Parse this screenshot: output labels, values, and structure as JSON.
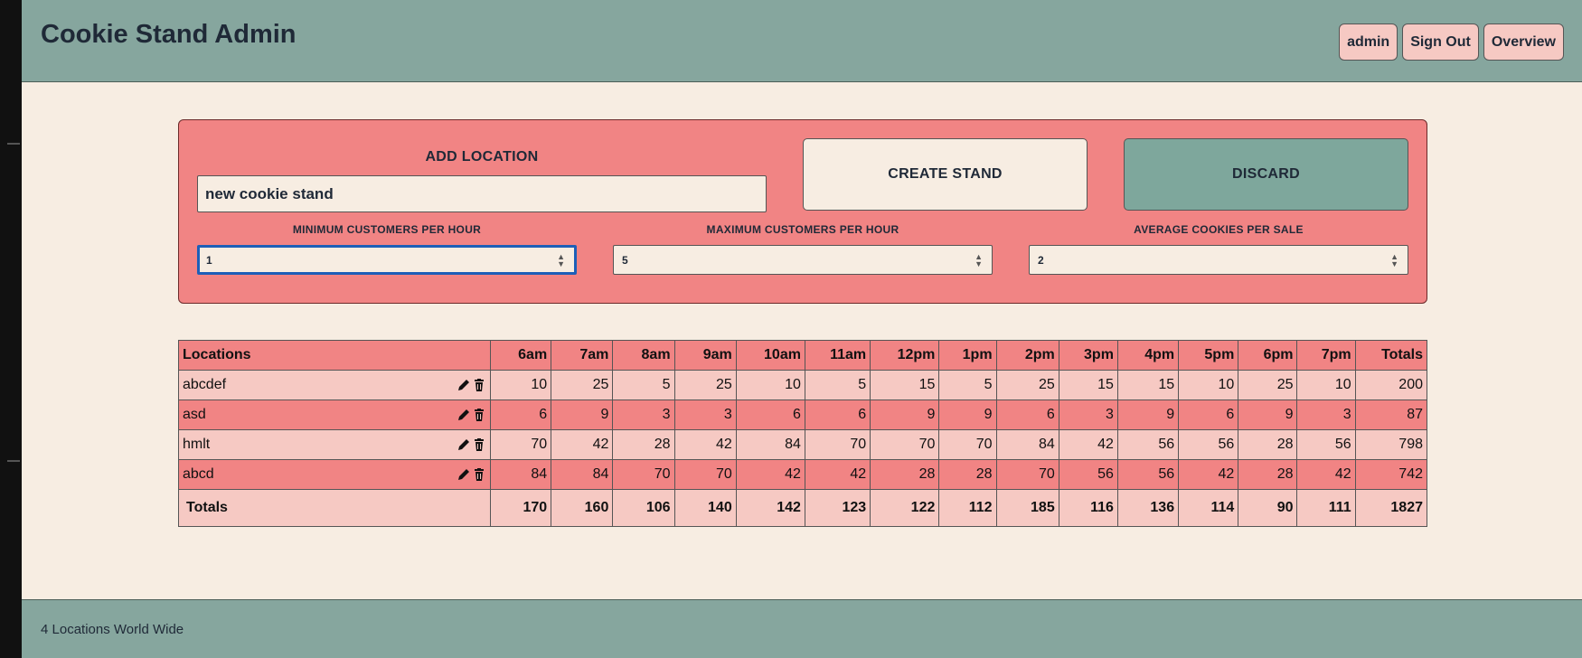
{
  "header": {
    "title": "Cookie Stand Admin",
    "nav": [
      "admin",
      "Sign Out",
      "Overview"
    ]
  },
  "form": {
    "add_label": "ADD LOCATION",
    "location_value": "new cookie stand",
    "create_label": "CREATE STAND",
    "discard_label": "DISCARD",
    "min_label": "MINIMUM CUSTOMERS PER HOUR",
    "min_value": "1",
    "max_label": "MAXIMUM CUSTOMERS PER HOUR",
    "max_value": "5",
    "avg_label": "AVERAGE COOKIES PER SALE",
    "avg_value": "2"
  },
  "table": {
    "headers": [
      "Locations",
      "6am",
      "7am",
      "8am",
      "9am",
      "10am",
      "11am",
      "12pm",
      "1pm",
      "2pm",
      "3pm",
      "4pm",
      "5pm",
      "6pm",
      "7pm",
      "Totals"
    ],
    "rows": [
      {
        "location": "abcdef",
        "values": [
          "10",
          "25",
          "5",
          "25",
          "10",
          "5",
          "15",
          "5",
          "25",
          "15",
          "15",
          "10",
          "25",
          "10",
          "200"
        ]
      },
      {
        "location": "asd",
        "values": [
          "6",
          "9",
          "3",
          "3",
          "6",
          "6",
          "9",
          "9",
          "6",
          "3",
          "9",
          "6",
          "9",
          "3",
          "87"
        ]
      },
      {
        "location": "hmlt",
        "values": [
          "70",
          "42",
          "28",
          "42",
          "84",
          "70",
          "70",
          "70",
          "84",
          "42",
          "56",
          "56",
          "28",
          "56",
          "798"
        ]
      },
      {
        "location": "abcd",
        "values": [
          "84",
          "84",
          "70",
          "70",
          "42",
          "42",
          "28",
          "28",
          "70",
          "56",
          "56",
          "42",
          "28",
          "42",
          "742"
        ]
      }
    ],
    "totals_label": "Totals",
    "totals": [
      "170",
      "160",
      "106",
      "140",
      "142",
      "123",
      "122",
      "112",
      "185",
      "116",
      "136",
      "114",
      "90",
      "111",
      "1827"
    ]
  },
  "footer": {
    "text": "4 Locations World Wide"
  },
  "colors": {
    "header_bg": "#86a69e",
    "panel_bg": "#f18484",
    "row_light": "#f6c9c3",
    "page_bg": "#f7ede2"
  }
}
